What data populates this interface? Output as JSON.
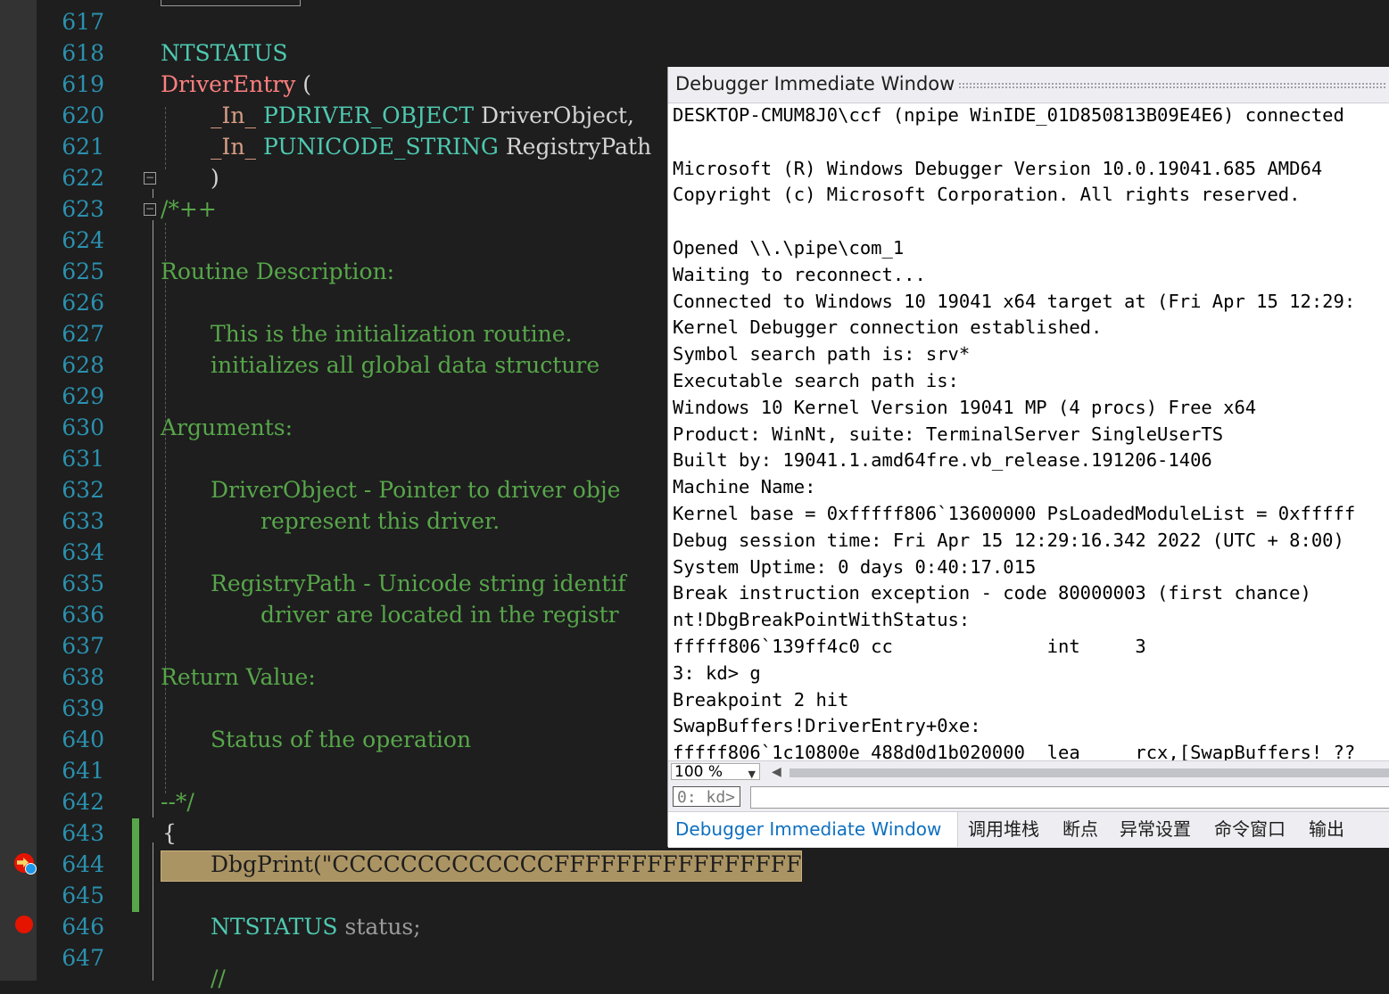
{
  "editor": {
    "line_numbers": [
      "617",
      "618",
      "619",
      "620",
      "621",
      "622",
      "623",
      "624",
      "625",
      "626",
      "627",
      "628",
      "629",
      "630",
      "631",
      "632",
      "633",
      "634",
      "635",
      "636",
      "637",
      "638",
      "639",
      "640",
      "641",
      "642",
      "643",
      "644",
      "645",
      "646",
      "647"
    ],
    "lines": {
      "l618": "NTSTATUS",
      "l619_fn": "DriverEntry",
      "l619_paren": " (",
      "l620_sal": "_In_",
      "l620_type": "PDRIVER_OBJECT",
      "l620_name": " DriverObject,",
      "l621_sal": "_In_",
      "l621_type": "PUNICODE_STRING",
      "l621_name": " RegistryPath",
      "l622": ")",
      "l623": "/*++",
      "l625": "Routine Description:",
      "l627": "This is the initialization routine.",
      "l628": "initializes all global data structure",
      "l630": "Arguments:",
      "l632": "DriverObject - Pointer to driver obje",
      "l633": "represent this driver.",
      "l635": "RegistryPath - Unicode string identif",
      "l636": "driver are located in the registr",
      "l638": "Return Value:",
      "l640": "Status of the operation",
      "l642": "--*/",
      "l643": "{",
      "l644": "DbgPrint(\"CCCCCCCCCCCCCFFFFFFFFFFFFFFFFF\\n\");",
      "l646_type": "NTSTATUS",
      "l646_name": " status;",
      "l647": "//"
    }
  },
  "debugger": {
    "title": "Debugger Immediate Window",
    "output": [
      "DESKTOP-CMUM8J0\\ccf (npipe WinIDE_01D850813B09E4E6) connected",
      "",
      "Microsoft (R) Windows Debugger Version 10.0.19041.685 AMD64",
      "Copyright (c) Microsoft Corporation. All rights reserved.",
      "",
      "Opened \\\\.\\pipe\\com_1",
      "Waiting to reconnect...",
      "Connected to Windows 10 19041 x64 target at (Fri Apr 15 12:29:",
      "Kernel Debugger connection established.",
      "Symbol search path is: srv*",
      "Executable search path is:",
      "Windows 10 Kernel Version 19041 MP (4 procs) Free x64",
      "Product: WinNt, suite: TerminalServer SingleUserTS",
      "Built by: 19041.1.amd64fre.vb_release.191206-1406",
      "Machine Name:",
      "Kernel base = 0xfffff806`13600000 PsLoadedModuleList = 0xfffff",
      "Debug session time: Fri Apr 15 12:29:16.342 2022 (UTC + 8:00)",
      "System Uptime: 0 days 0:40:17.015",
      "Break instruction exception - code 80000003 (first chance)",
      "nt!DbgBreakPointWithStatus:",
      "fffff806`139ff4c0 cc              int     3",
      "3: kd> g",
      "Breakpoint 2 hit",
      "SwapBuffers!DriverEntry+0xe:",
      "fffff806`1c10800e 488d0d1b020000  lea     rcx,[SwapBuffers! ??"
    ],
    "zoom": "100 %",
    "prompt": "0: kd>",
    "command_value": "",
    "tabs": [
      "Debugger Immediate Window",
      "调用堆栈",
      "断点",
      "异常设置",
      "命令窗口",
      "输出"
    ]
  },
  "colors": {
    "editor_bg": "#1e1e1e",
    "line_number": "#2b91af",
    "comment": "#57a64a",
    "type": "#4ec9b0",
    "function": "#ff8080",
    "current_line": "#ab9463",
    "breakpoint": "#e51400",
    "tab_active": "#0e70c0"
  }
}
